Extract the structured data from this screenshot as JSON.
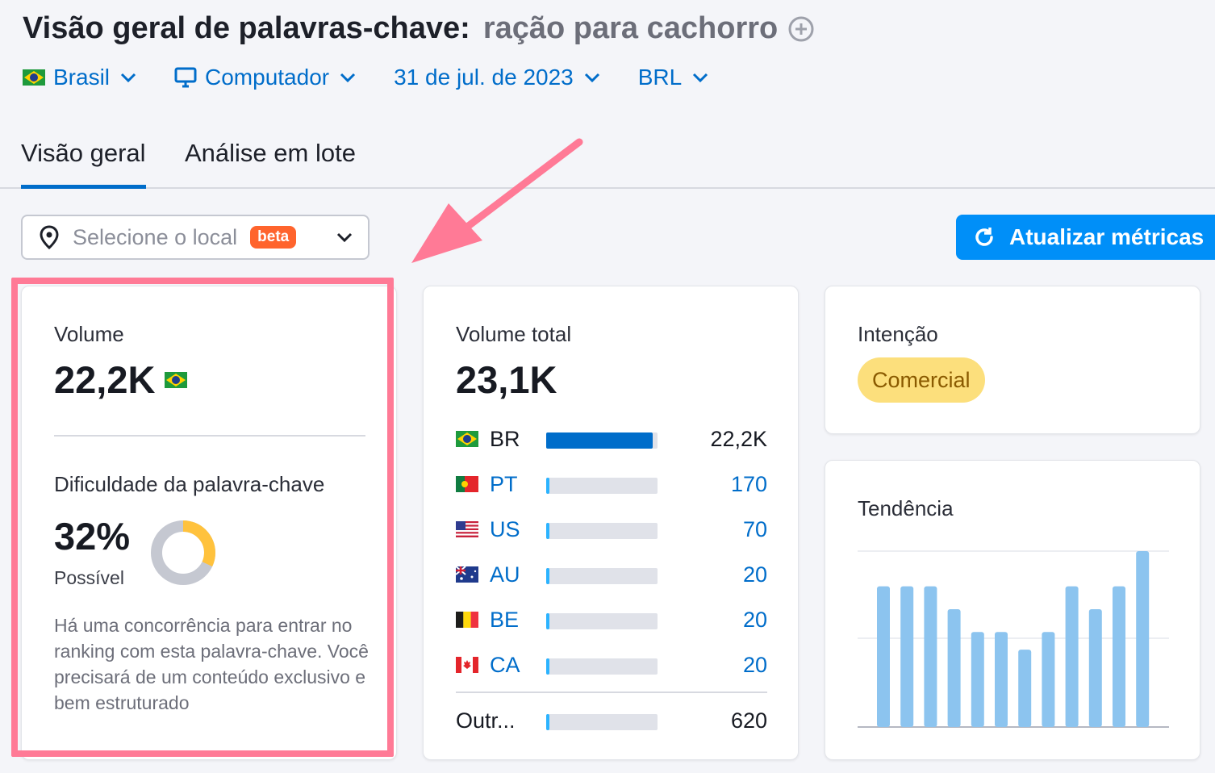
{
  "header": {
    "title": "Visão geral de palavras-chave:",
    "keyword": "ração para cachorro"
  },
  "filters": {
    "country": "Brasil",
    "device": "Computador",
    "date": "31 de jul. de 2023",
    "currency": "BRL"
  },
  "tabs": [
    {
      "label": "Visão geral",
      "active": true
    },
    {
      "label": "Análise em lote",
      "active": false
    }
  ],
  "location_select": {
    "placeholder": "Selecione o local",
    "badge": "beta"
  },
  "update_button": {
    "label": "Atualizar métricas"
  },
  "volume_card": {
    "label": "Volume",
    "value": "22,2K",
    "difficulty_label": "Dificuldade da palavra-chave",
    "difficulty_value": "32%",
    "difficulty_level": "Possível",
    "difficulty_percent": 32,
    "description": "Há uma concorrência para entrar no ranking com esta palavra-chave. Você precisará de um conteúdo exclusivo e bem estruturado"
  },
  "total_volume_card": {
    "label": "Volume total",
    "value": "23,1K",
    "rows": [
      {
        "code": "BR",
        "value": "22,2K",
        "share": 0.96
      },
      {
        "code": "PT",
        "value": "170",
        "share": 0.03
      },
      {
        "code": "US",
        "value": "70",
        "share": 0.03
      },
      {
        "code": "AU",
        "value": "20",
        "share": 0.03
      },
      {
        "code": "BE",
        "value": "20",
        "share": 0.03
      },
      {
        "code": "CA",
        "value": "20",
        "share": 0.03
      }
    ],
    "others": {
      "label": "Outr...",
      "value": "620",
      "share": 0.03
    }
  },
  "intent_card": {
    "label": "Intenção",
    "intent": "Comercial"
  },
  "trend_card": {
    "label": "Tendência",
    "chart_data": {
      "type": "bar",
      "values": [
        80,
        80,
        80,
        67,
        54,
        54,
        44,
        54,
        80,
        67,
        80,
        100
      ],
      "ylim": [
        0,
        100
      ],
      "color": "#8cc4ef"
    }
  },
  "colors": {
    "accent": "#006dca",
    "button": "#008ff8",
    "difficulty": "#ffc23d",
    "highlight": "#ff7a96"
  }
}
